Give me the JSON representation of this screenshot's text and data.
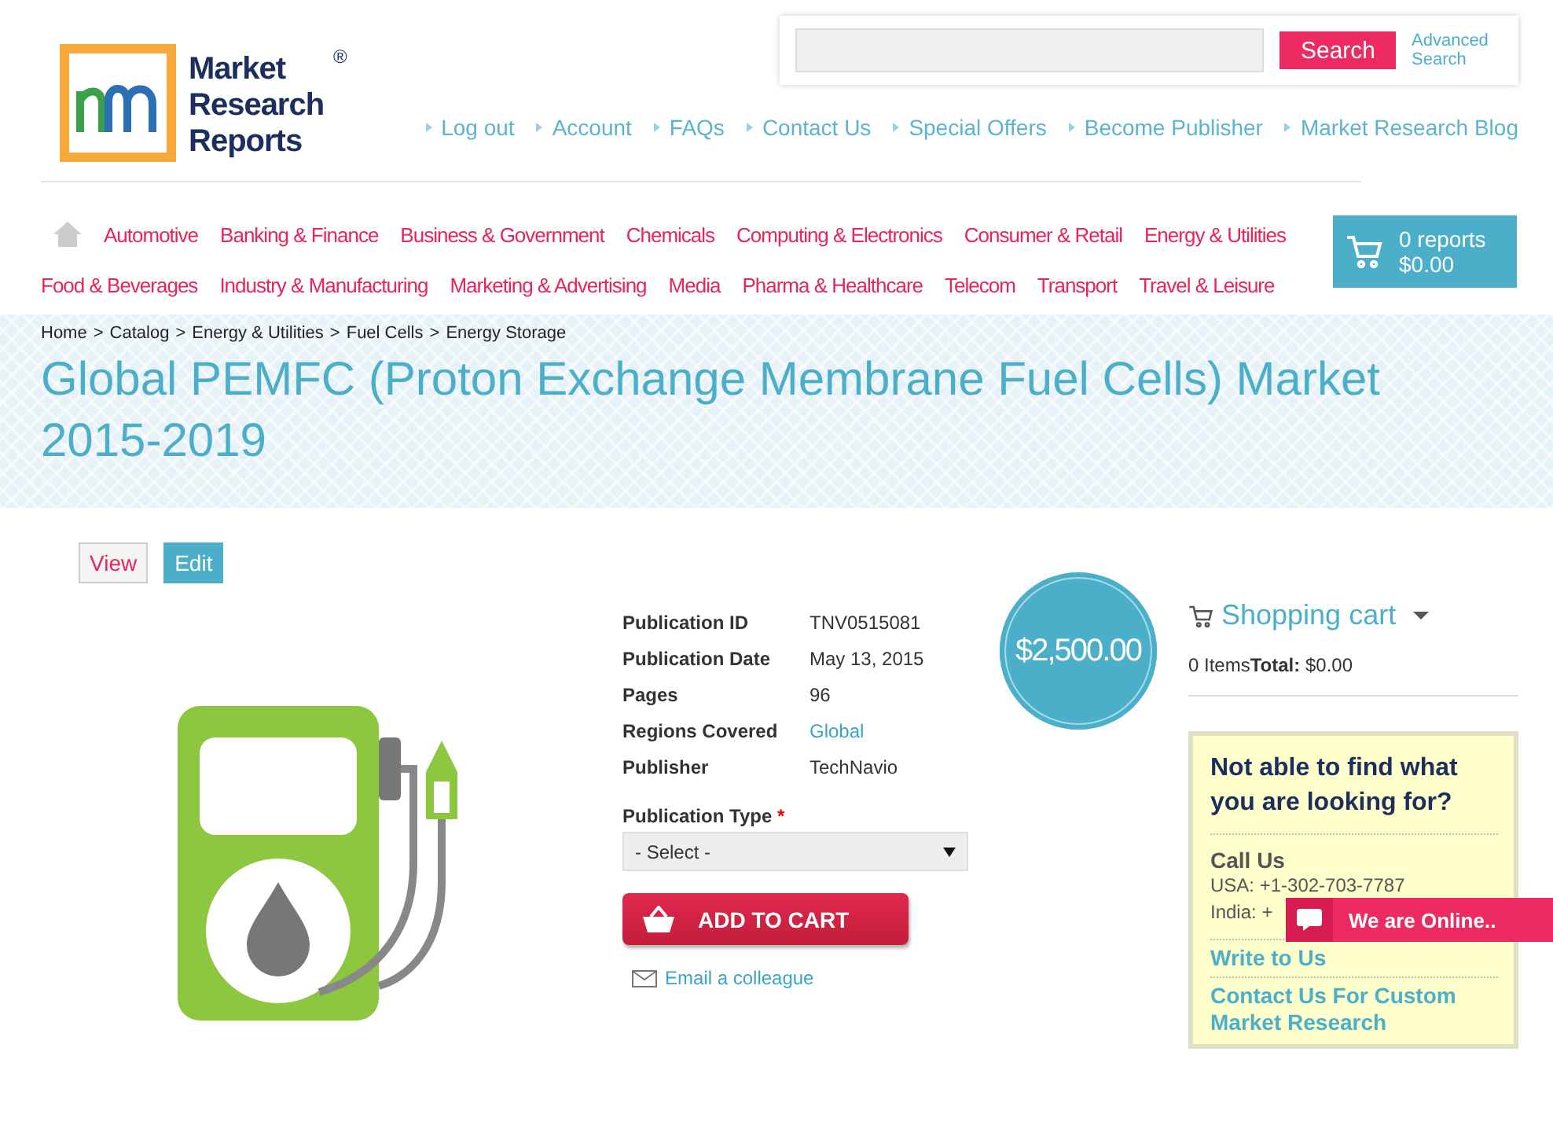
{
  "logo": {
    "name_lines": [
      "Market",
      "Research",
      "Reports"
    ],
    "mark": "®"
  },
  "search": {
    "button": "Search",
    "advanced": "Advanced Search"
  },
  "top_links": [
    "Log out",
    "Account",
    "FAQs",
    "Contact Us",
    "Special Offers",
    "Become Publisher",
    "Market Research Blog"
  ],
  "category_rows": [
    [
      "Automotive",
      "Banking & Finance",
      "Business & Government",
      "Chemicals",
      "Computing & Electronics",
      "Consumer & Retail",
      "Energy & Utilities"
    ],
    [
      "Food & Beverages",
      "Industry & Manufacturing",
      "Marketing & Advertising",
      "Media",
      "Pharma & Healthcare",
      "Telecom",
      "Transport",
      "Travel & Leisure"
    ]
  ],
  "cart_button": {
    "count": "0 reports",
    "total": "$0.00"
  },
  "breadcrumb": {
    "items": [
      "Home",
      "Catalog",
      "Energy & Utilities",
      "Fuel Cells",
      "Energy Storage"
    ],
    "separator": ">"
  },
  "title": "Global PEMFC (Proton Exchange Membrane Fuel Cells) Market 2015-2019",
  "view_tabs": [
    {
      "label": "View",
      "selected": true
    },
    {
      "label": "Edit",
      "selected": false
    }
  ],
  "details": [
    {
      "label": "Publication ID",
      "value": "TNV0515081",
      "link": false
    },
    {
      "label": "Publication Date",
      "value": "May 13, 2015",
      "link": false
    },
    {
      "label": "Pages",
      "value": "96",
      "link": false
    },
    {
      "label": "Regions Covered",
      "value": "Global",
      "link": true
    },
    {
      "label": "Publisher",
      "value": "TechNavio",
      "link": false
    }
  ],
  "publication_type": {
    "label": "Publication Type",
    "required_mark": "*",
    "value": "- Select -"
  },
  "add_to_cart": "ADD TO CART",
  "email_link": "Email a colleague",
  "price": "$2,500.00",
  "shopping_cart": {
    "title": "Shopping cart",
    "items": "0 Items",
    "total_label": "Total:",
    "total": "$0.00"
  },
  "help_box": {
    "heading": "Not able to find what you are looking for?",
    "call_title": "Call Us",
    "phones": [
      "USA: +1-302-703-7787",
      "India: +"
    ],
    "links": [
      "Write to Us",
      "Contact Us For Custom Market Research"
    ]
  },
  "chat": {
    "label": "We are Online.."
  }
}
